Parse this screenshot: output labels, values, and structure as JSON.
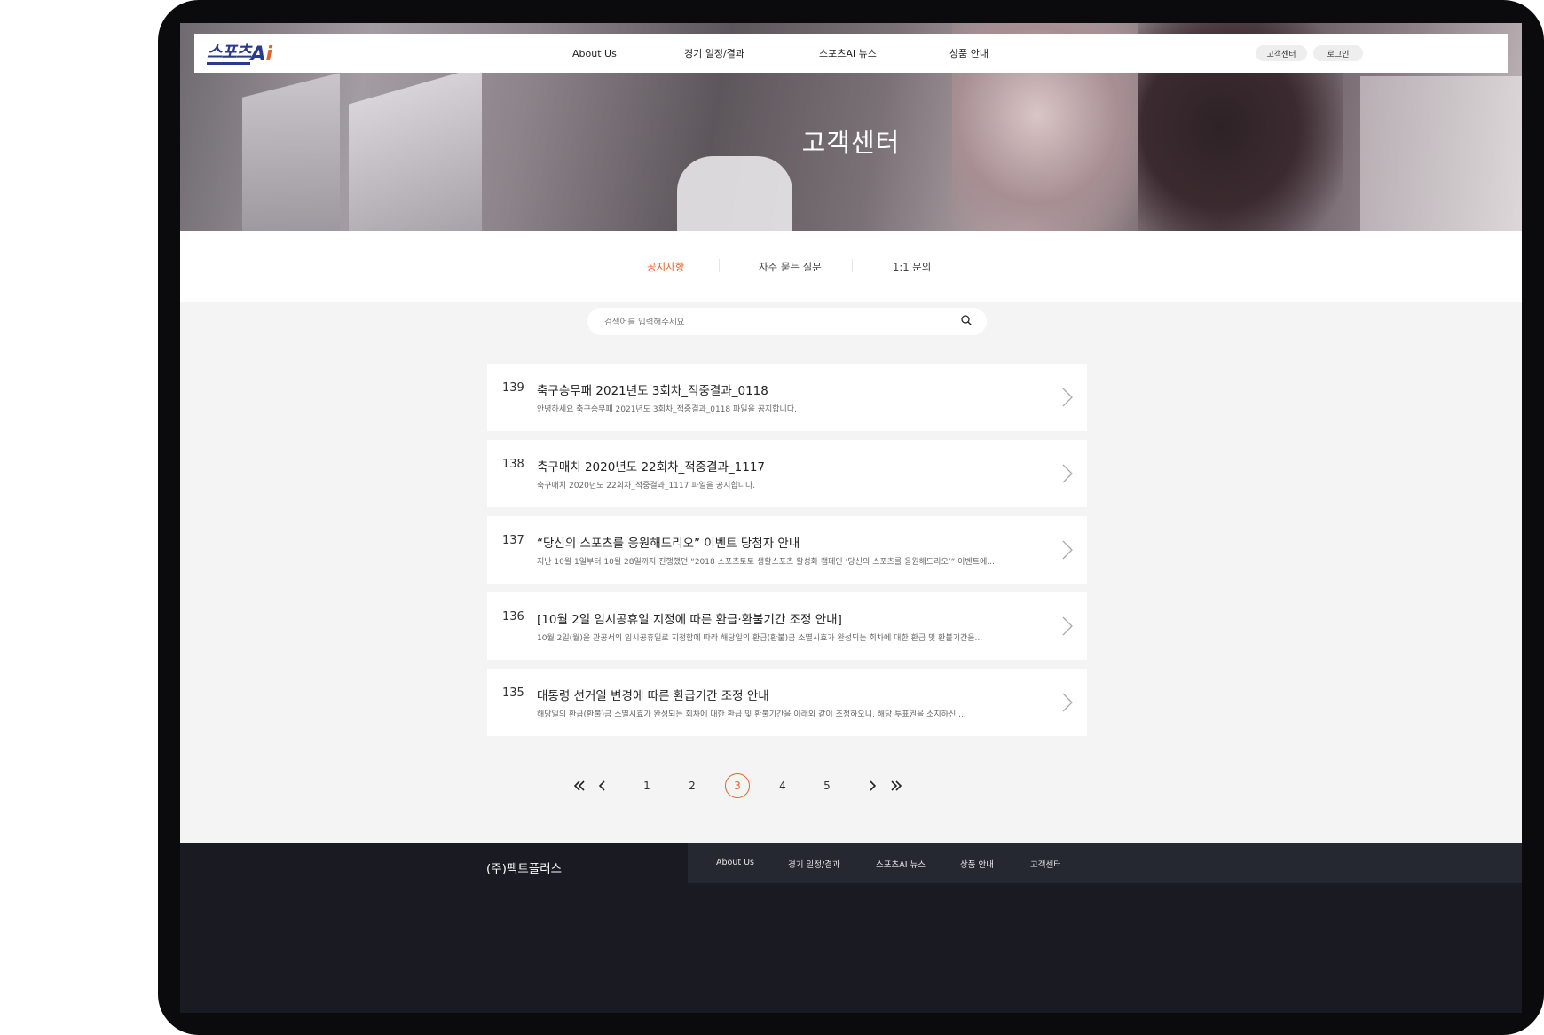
{
  "brand": {
    "logo_ko": "스포츠",
    "logo_a": "A",
    "logo_i": "i"
  },
  "nav": {
    "items": [
      "About Us",
      "경기 일정/결과",
      "스포츠AI 뉴스",
      "상품 안내"
    ],
    "support_label": "고객센터",
    "login_label": "로그인"
  },
  "hero": {
    "title": "고객센터"
  },
  "tabs": [
    {
      "label": "공지사항",
      "active": true
    },
    {
      "label": "자주 묻는 질문",
      "active": false
    },
    {
      "label": "1:1 문의",
      "active": false
    }
  ],
  "search": {
    "placeholder": "검색어를 입력해주세요",
    "icon": "search-icon"
  },
  "notices": [
    {
      "num": "139",
      "title": "축구승무패 2021년도 3회차_적중결과_0118",
      "desc": "안녕하세요  축구승무패 2021년도 3회차_적중결과_0118 파일을 공지합니다."
    },
    {
      "num": "138",
      "title": "축구매치 2020년도 22회차_적중결과_1117",
      "desc": "축구매치 2020년도 22회차_적중결과_1117 파일을 공지합니다."
    },
    {
      "num": "137",
      "title": "“당신의 스포츠를 응원해드리오” 이벤트 당첨자 안내",
      "desc": "지난 10월 1일부터 10월 28일까지 진행했던 “2018 스포츠토토 생활스포츠 활성화 캠페인 ‘당신의 스포츠를 응원해드리오’” 이벤트에..."
    },
    {
      "num": "136",
      "title": "[10월 2일 임시공휴일 지정에 따른 환급·환불기간 조정 안내]",
      "desc": "10월 2일(월)을 관공서의 임시공휴일로 지정함에 따라 해당일의 환급(환불)금 소멸시효가 완성되는 회차에 대한 환급 및 환불기간을..."
    },
    {
      "num": "135",
      "title": "대통령 선거일 변경에 따른 환급기간 조정 안내",
      "desc": "해당일의 환급(환불)금 소멸시효가 완성되는 회차에 대한 환급 및 환불기간을 아래와 같이 조정하오니, 해당 투표권을 소지하신 ..."
    }
  ],
  "pagination": {
    "pages": [
      "1",
      "2",
      "3",
      "4",
      "5"
    ],
    "current": "3"
  },
  "footer": {
    "company": "(주)팩트플러스",
    "nav": [
      "About Us",
      "경기 일정/결과",
      "스포츠AI 뉴스",
      "상품 안내",
      "고객센터"
    ]
  },
  "colors": {
    "accent": "#e8622a",
    "brand": "#2a3b8f",
    "footer_bg": "#191a22"
  }
}
